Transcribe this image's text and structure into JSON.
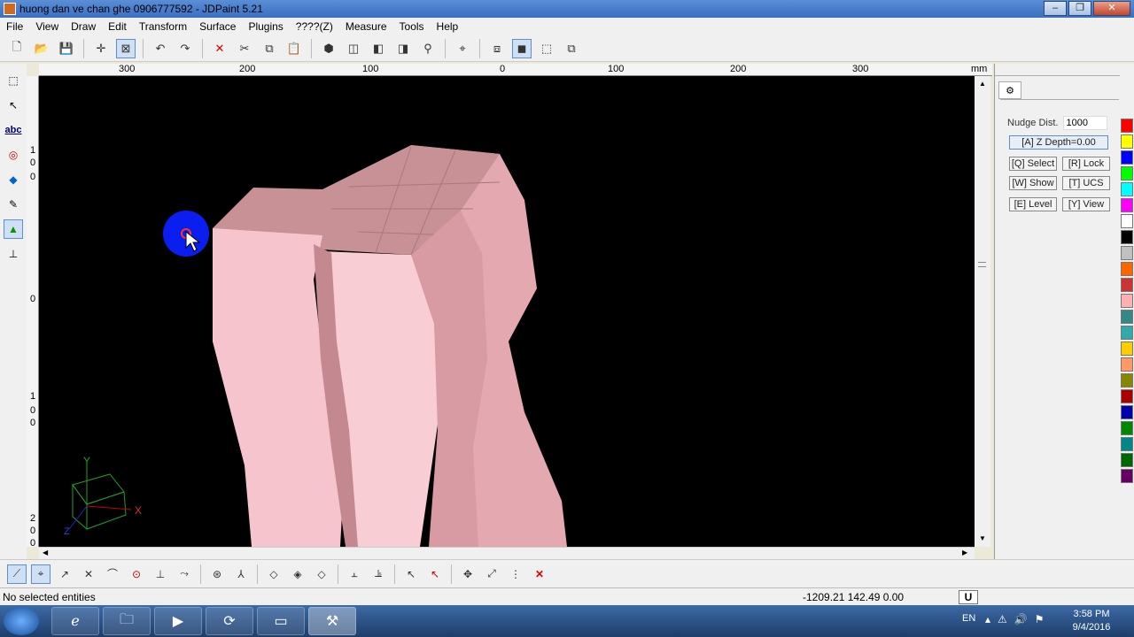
{
  "window": {
    "title": "huong dan ve chan ghe 0906777592 - JDPaint 5.21",
    "buttons": [
      "‒",
      "❐",
      "✕"
    ]
  },
  "menu": [
    "File",
    "View",
    "Draw",
    "Edit",
    "Transform",
    "Surface",
    "Plugins",
    "????(Z)",
    "Measure",
    "Tools",
    "Help"
  ],
  "toolbar": {
    "icons": [
      "new-icon",
      "open-icon",
      "save-icon",
      "crosshair-icon",
      "select-window-icon",
      "undo-icon",
      "redo-icon",
      "delete-icon",
      "cut-icon",
      "copy-icon",
      "paste-icon",
      "solid-icon",
      "box-icon",
      "box2-icon",
      "box3-icon",
      "view-icon",
      "axes-icon",
      "layers-icon",
      "shade-icon",
      "wire-icon",
      "render-icon"
    ]
  },
  "ruler": {
    "top_labels": [
      "300",
      "200",
      "100",
      "0",
      "100",
      "200",
      "300",
      "mm"
    ],
    "left_labels": [
      "1",
      "0",
      "0",
      "0",
      "1",
      "0",
      "0",
      "2",
      "0",
      "0"
    ]
  },
  "left_tools": {
    "abc_label": "abc"
  },
  "right_panel": {
    "nudge_label": "Nudge Dist.",
    "nudge_value": "1000",
    "zdepth_button": "[A] Z Depth=0.00",
    "buttons": [
      "[Q] Select",
      "[R] Lock",
      "[W] Show",
      "[T] UCS",
      "[E] Level",
      "[Y] View"
    ]
  },
  "axis_gizmo": {
    "y": "Y",
    "x": "X",
    "z": "Z"
  },
  "palette": {
    "colors": [
      "#ff0000",
      "#ffff00",
      "#0000ff",
      "#00ff00",
      "#00ffff",
      "#ff00ff",
      "#ffffff",
      "#000000",
      "#c0c0c0",
      "#ff6600",
      "#cc3333",
      "#ffb0b0",
      "#338888",
      "#33aaaa",
      "#ffcc00",
      "#ff9966",
      "#888800",
      "#aa0000",
      "#0000aa",
      "#008800",
      "#008888",
      "#006600",
      "#660066"
    ]
  },
  "status": {
    "message": "No selected entities",
    "coords": "-1209.21 142.49 0.00",
    "units": "U"
  },
  "taskbar": {
    "lang": "EN",
    "time": "3:58 PM",
    "date": "9/4/2016"
  },
  "accent": "#3b6fc2",
  "model_color": "#f6c4cc",
  "cursor_marker_color": "#0a1ef0"
}
